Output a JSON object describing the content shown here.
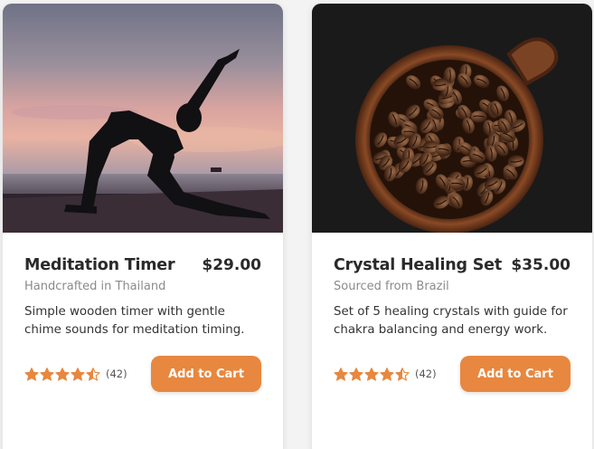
{
  "colors": {
    "accent": "#e8873f",
    "star": "#e8873f"
  },
  "products": [
    {
      "image_alt": "yoga-pose-sunset-silhouette",
      "title": "Meditation Timer",
      "price": "$29.00",
      "origin": "Handcrafted in Thailand",
      "description": "Simple wooden timer with gentle chime sounds for meditation timing.",
      "rating": 4.5,
      "review_count": "(42)",
      "cart_label": "Add to Cart"
    },
    {
      "image_alt": "coffee-beans-in-cup",
      "title": "Crystal Healing Set",
      "price": "$35.00",
      "origin": "Sourced from Brazil",
      "description": "Set of 5 healing crystals with guide for chakra balancing and energy work.",
      "rating": 4.5,
      "review_count": "(42)",
      "cart_label": "Add to Cart"
    }
  ]
}
